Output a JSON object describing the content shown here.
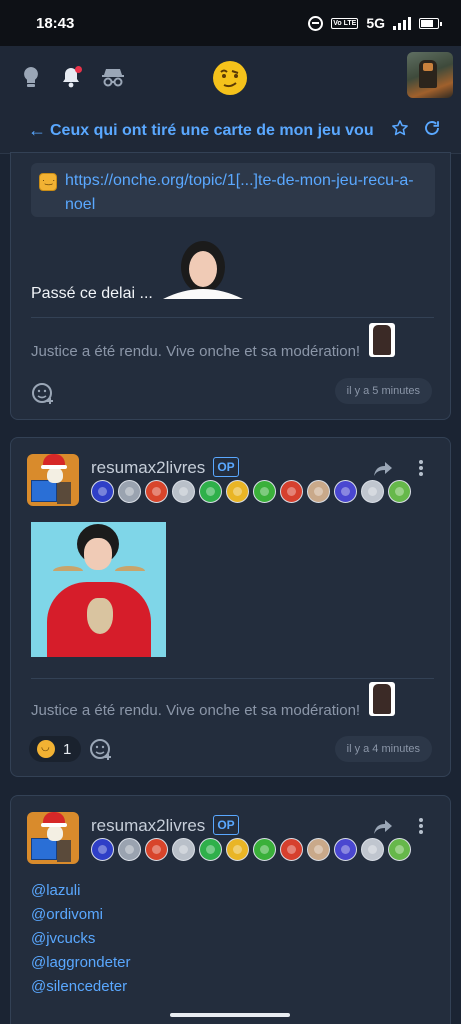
{
  "status": {
    "time": "18:43",
    "volte": "Vo LTE",
    "network": "5G"
  },
  "topic": {
    "title": "Ceux qui ont tiré une carte de mon jeu vou"
  },
  "posts": [
    {
      "link": "https://onche.org/topic/1[...]te-de-mon-jeu-recu-a-noel",
      "text": "Passé ce delai ...",
      "signature": "Justice a été rendu. Vive onche et sa modération!",
      "time": "il y a 5 minutes"
    },
    {
      "author": "resumax2livres",
      "op": "OP",
      "signature": "Justice a été rendu. Vive onche et sa modération!",
      "reaction_count": "1",
      "time": "il y a 4 minutes"
    },
    {
      "author": "resumax2livres",
      "op": "OP",
      "mentions": [
        "@lazuli",
        "@ordivomi",
        "@jvcucks",
        "@laggrondeter",
        "@silencedeter"
      ]
    }
  ],
  "badge_colors": [
    "#2f3fc7",
    "#9aa3b0",
    "#d8452b",
    "#b9c0c9",
    "#2fb04a",
    "#e9b526",
    "#3ab03a",
    "#d6402e",
    "#c9a98a",
    "#4a47d0",
    "#c0c6cf",
    "#66b84a"
  ],
  "icons": {
    "bulb": "lightbulb-icon",
    "bell": "bell-icon",
    "incognito": "incognito-icon",
    "logo": "smiley-logo",
    "star": "star-icon",
    "refresh": "refresh-icon",
    "share": "share-icon",
    "more": "more-vertical-icon",
    "add_reaction": "add-reaction-icon"
  },
  "colors": {
    "accent": "#5aa8ff",
    "background": "#1b2433",
    "card": "#232d3d"
  }
}
